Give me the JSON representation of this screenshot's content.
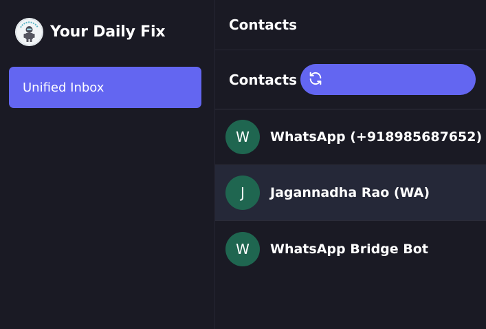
{
  "sidebar": {
    "brand_title": "Your Daily Fix",
    "logo_icon": "robot-logo-icon",
    "nav_items": [
      {
        "label": "Unified Inbox",
        "active": true
      }
    ]
  },
  "main": {
    "header_title": "Contacts",
    "subheader_title": "Contacts",
    "refresh_icon": "refresh-icon",
    "contacts": [
      {
        "initial": "W",
        "name": "WhatsApp (+918985687652)",
        "selected": false
      },
      {
        "initial": "J",
        "name": "Jagannadha Rao (WA)",
        "selected": true
      },
      {
        "initial": "W",
        "name": "WhatsApp Bridge Bot",
        "selected": false
      }
    ]
  },
  "colors": {
    "background": "#1a1a24",
    "accent": "#6366f1",
    "avatar": "#1f6650",
    "selected_row": "#252838"
  }
}
